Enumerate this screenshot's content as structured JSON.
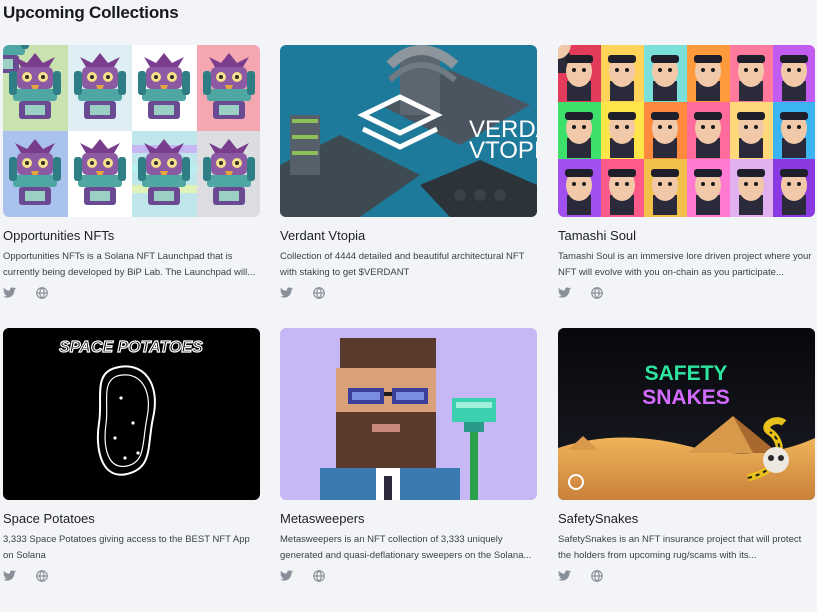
{
  "section": {
    "title": "Upcoming Collections"
  },
  "cards": [
    {
      "name": "Opportunities NFTs",
      "description": "Opportunities NFTs is a Solana NFT Launchpad that is currently being developed by BiP Lab. The Launchpad will...",
      "image": "opportunities-totem-grid"
    },
    {
      "name": "Verdant Vtopia",
      "description": "Collection of 4444 detailed and beautiful architectural NFT with staking to get $VERDANT",
      "image": "verdant-isometric-city",
      "image_text": "VERDANT VTOPIA"
    },
    {
      "name": "Tamashi Soul",
      "description": "Tamashi Soul is an immersive lore driven project where your NFT will evolve with you on-chain as you participate...",
      "image": "tamashi-avatar-grid"
    },
    {
      "name": "Space Potatoes",
      "description": "3,333 Space Potatoes giving access to the BEST NFT App on Solana",
      "image": "space-potato-outline",
      "image_text": "SPACE POTATOES"
    },
    {
      "name": "Metasweepers",
      "description": "Metasweepers is an NFT collection of 3,333 uniquely generated and quasi-deflationary sweepers on the Solana...",
      "image": "pixel-bearded-man-sweeper"
    },
    {
      "name": "SafetySnakes",
      "description": "SafetySnakes is an NFT insurance project that will protect the holders from upcoming rug/scams with its...",
      "image": "desert-snake-skull",
      "image_text_1": "SAFETY",
      "image_text_2": "SNAKES"
    }
  ],
  "icons": {
    "twitter": "twitter-icon",
    "website": "globe-icon"
  },
  "colors": {
    "background": "#f2f4f7",
    "icon": "#8a9099"
  }
}
